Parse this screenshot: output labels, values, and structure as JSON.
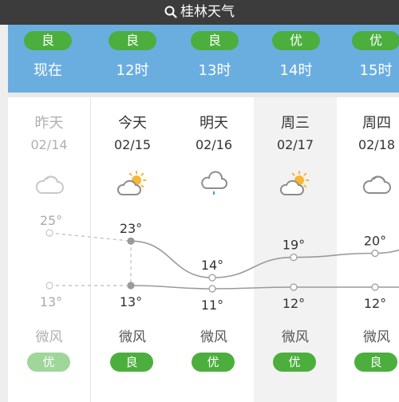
{
  "search": {
    "title": "桂林天气",
    "icon": "search-icon"
  },
  "hourly": [
    {
      "aqi": "良",
      "label": "现在"
    },
    {
      "aqi": "良",
      "label": "12时"
    },
    {
      "aqi": "良",
      "label": "13时"
    },
    {
      "aqi": "优",
      "label": "14时"
    },
    {
      "aqi": "优",
      "label": "15时"
    }
  ],
  "daily": [
    {
      "name": "昨天",
      "date": "02/14",
      "icon": "cloudy-icon",
      "high": "25°",
      "low": "13°",
      "high_val": 25,
      "low_val": 13,
      "wind": "微风",
      "aqi": "优"
    },
    {
      "name": "今天",
      "date": "02/15",
      "icon": "partly-cloudy-icon",
      "high": "23°",
      "low": "13°",
      "high_val": 23,
      "low_val": 13,
      "wind": "微风",
      "aqi": "良"
    },
    {
      "name": "明天",
      "date": "02/16",
      "icon": "light-rain-icon",
      "high": "14°",
      "low": "11°",
      "high_val": 14,
      "low_val": 11,
      "wind": "微风",
      "aqi": "优"
    },
    {
      "name": "周三",
      "date": "02/17",
      "icon": "partly-cloudy-icon",
      "high": "19°",
      "low": "12°",
      "high_val": 19,
      "low_val": 12,
      "wind": "微风",
      "aqi": "优"
    },
    {
      "name": "周四",
      "date": "02/18",
      "icon": "cloudy-icon",
      "high": "20°",
      "low": "12°",
      "high_val": 20,
      "low_val": 12,
      "wind": "微风",
      "aqi": "良"
    }
  ],
  "colors": {
    "aqi_green": "#4caf3d",
    "hourly_bg": "#6aaee0",
    "topbar_bg": "#3c3c3c"
  }
}
